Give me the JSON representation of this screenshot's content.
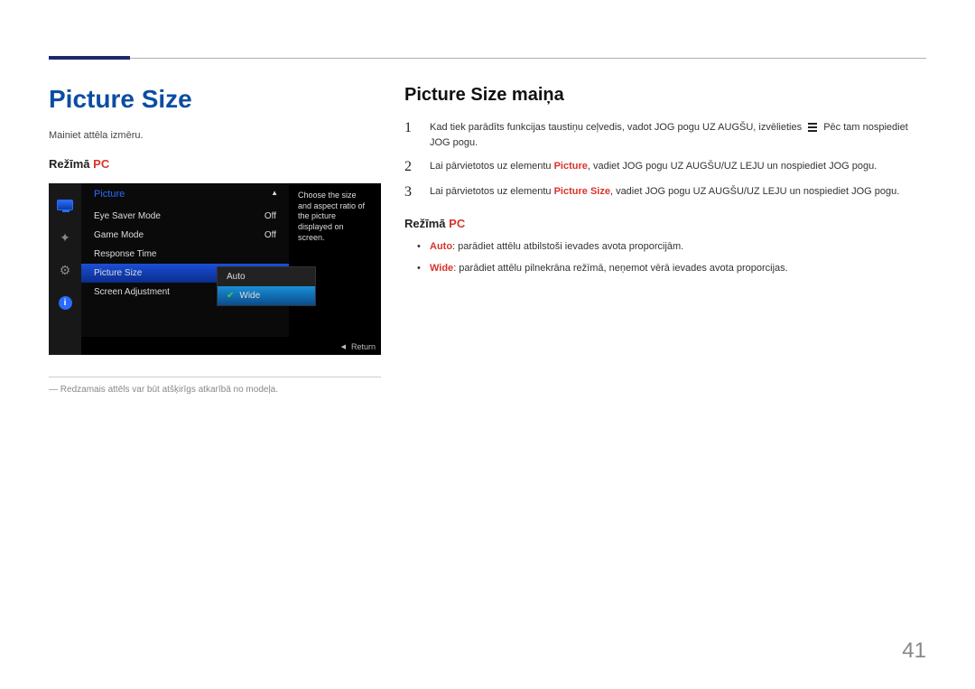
{
  "page_number": "41",
  "left": {
    "title": "Picture Size",
    "intro": "Mainiet attēla izmēru.",
    "mode_label": "Režīmā",
    "mode_value": "PC",
    "footnote": "Redzamais attēls var būt atšķirīgs atkarībā no modeļa."
  },
  "osd": {
    "header": "Picture",
    "rows": [
      {
        "label": "Eye Saver Mode",
        "value": "Off"
      },
      {
        "label": "Game Mode",
        "value": "Off"
      },
      {
        "label": "Response Time",
        "value": ""
      },
      {
        "label": "Picture Size",
        "value": "Auto"
      },
      {
        "label": "Screen Adjustment",
        "value": ""
      }
    ],
    "submenu": {
      "opt1": "Auto",
      "opt2": "Wide"
    },
    "help": "Choose the size and aspect ratio of the picture displayed on screen.",
    "return": "Return"
  },
  "right": {
    "heading": "Picture Size maiņa",
    "steps": {
      "s1a": "Kad tiek parādīts funkcijas taustiņu ceļvedis, vadot JOG pogu UZ AUGŠU, izvēlieties",
      "s1b": "Pēc tam nospiediet JOG pogu.",
      "s2a": "Lai pārvietotos uz elementu",
      "s2kw1": "Picture",
      "s2b": ", vadiet JOG pogu UZ AUGŠU/UZ LEJU un nospiediet JOG pogu.",
      "s3a": "Lai pārvietotos uz elementu",
      "s3kw1": "Picture Size",
      "s3b": ", vadiet JOG pogu UZ AUGŠU/UZ LEJU un nospiediet JOG pogu."
    },
    "mode_label": "Režīmā",
    "mode_value": "PC",
    "bullets": {
      "b1kw": "Auto",
      "b1": ": parādiet attēlu atbilstoši ievades avota proporcijām.",
      "b2kw": "Wide",
      "b2": ": parādiet attēlu pilnekrāna režīmā, neņemot vērā ievades avota proporcijas."
    }
  }
}
